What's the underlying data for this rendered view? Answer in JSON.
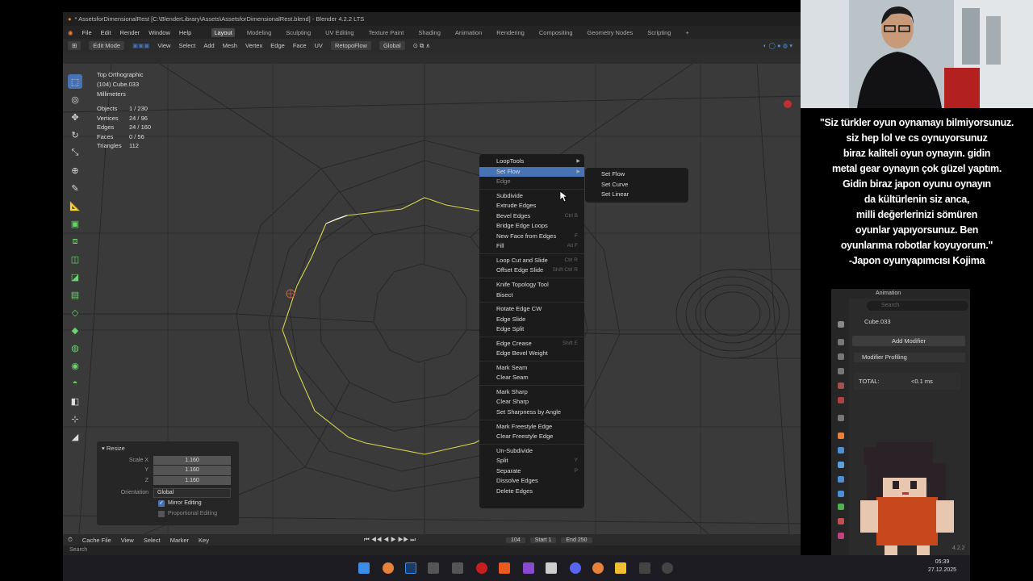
{
  "window_title": "* AssetsforDimensionalRest [C:\\BlenderLibrary\\Assets\\AssetsforDimensionalRest.blend] - Blender 4.2.2 LTS",
  "menu": [
    "File",
    "Edit",
    "Render",
    "Window",
    "Help"
  ],
  "workspaces": [
    "Layout",
    "Modeling",
    "Sculpting",
    "UV Editing",
    "Texture Paint",
    "Shading",
    "Animation",
    "Rendering",
    "Compositing",
    "Geometry Nodes",
    "Scripting"
  ],
  "header": {
    "mode": "Edit Mode",
    "items": [
      "View",
      "Select",
      "Add",
      "Mesh",
      "Vertex",
      "Edge",
      "Face",
      "UV"
    ],
    "retopo": "RetopoFlow",
    "orientation": "Global"
  },
  "viewport_info": {
    "view": "Top Orthographic",
    "object": "(104) Cube.033",
    "units": "Millimeters"
  },
  "stats": [
    {
      "k": "Objects",
      "v": "1 / 230"
    },
    {
      "k": "Vertices",
      "v": "24 / 96"
    },
    {
      "k": "Edges",
      "v": "24 / 160"
    },
    {
      "k": "Faces",
      "v": "0 / 56"
    },
    {
      "k": "Triangles",
      "v": "112"
    }
  ],
  "resize": {
    "title": "Resize",
    "scale_x_label": "Scale X",
    "y_label": "Y",
    "z_label": "Z",
    "sx": "1.160",
    "sy": "1.160",
    "sz": "1.160",
    "orientation_label": "Orientation",
    "orientation": "Global",
    "mirror": "Mirror Editing",
    "proportional": "Proportional Editing"
  },
  "context_menu": [
    {
      "label": "LoopTools",
      "arrow": true
    },
    {
      "label": "Set Flow",
      "arrow": true,
      "highlight": true
    },
    {
      "label": "Edge",
      "dim": true
    },
    {
      "sep": true
    },
    {
      "label": "Subdivide"
    },
    {
      "label": "Extrude Edges"
    },
    {
      "label": "Bevel Edges",
      "sc": "Ctrl B"
    },
    {
      "label": "Bridge Edge Loops"
    },
    {
      "label": "New Face from Edges",
      "sc": "F"
    },
    {
      "label": "Fill",
      "sc": "Alt F"
    },
    {
      "sep": true
    },
    {
      "label": "Loop Cut and Slide",
      "sc": "Ctrl R"
    },
    {
      "label": "Offset Edge Slide",
      "sc": "Shift Ctrl R"
    },
    {
      "sep": true
    },
    {
      "label": "Knife Topology Tool"
    },
    {
      "label": "Bisect"
    },
    {
      "sep": true
    },
    {
      "label": "Rotate Edge CW"
    },
    {
      "label": "Edge Slide"
    },
    {
      "label": "Edge Split"
    },
    {
      "sep": true
    },
    {
      "label": "Edge Crease",
      "sc": "Shift E"
    },
    {
      "label": "Edge Bevel Weight"
    },
    {
      "sep": true
    },
    {
      "label": "Mark Seam"
    },
    {
      "label": "Clear Seam"
    },
    {
      "sep": true
    },
    {
      "label": "Mark Sharp"
    },
    {
      "label": "Clear Sharp"
    },
    {
      "label": "Set Sharpness by Angle"
    },
    {
      "sep": true
    },
    {
      "label": "Mark Freestyle Edge"
    },
    {
      "label": "Clear Freestyle Edge"
    },
    {
      "sep": true
    },
    {
      "label": "Un-Subdivide"
    },
    {
      "label": "Split",
      "sc": "Y"
    },
    {
      "label": "Separate",
      "sc": "P"
    },
    {
      "label": "Dissolve Edges"
    },
    {
      "label": "Delete Edges"
    }
  ],
  "submenu": [
    "Set Flow",
    "Set Curve",
    "Set Linear"
  ],
  "timeline": {
    "items": [
      "Cache File",
      "View",
      "Select",
      "Marker",
      "Key"
    ],
    "frame": "104",
    "start_label": "Start",
    "start": "1",
    "end_label": "End",
    "end": "250"
  },
  "status": "Search",
  "quote": [
    "\"Siz türkler oyun oynamayı bilmiyorsunuz.",
    "siz hep lol ve cs oynuyorsunuz",
    "biraz kaliteli oyun oynayın. gidin",
    "metal gear oynayın çok güzel yaptım.",
    "Gidin biraz japon oyunu oynayın",
    "da kültürlenin siz anca,",
    "milli değerlerinizi sömüren",
    "oyunlar yapıyorsunuz. Ben",
    "oyunlarıma robotlar koyuyorum.\"",
    "-Japon oyunyapımcısı Kojima"
  ],
  "properties": {
    "header": "Animation",
    "search": "Search",
    "object": "Cube.033",
    "add_modifier": "Add Modifier",
    "profiling": "Modifier Profiling",
    "total_label": "TOTAL:",
    "total_value": "<0.1 ms",
    "version": "4.2.2"
  },
  "clock": {
    "time": "05:39",
    "date": "27.12.2025"
  },
  "colors": {
    "selected_edge": "#d6d650",
    "active_blue": "#4772b3",
    "blender_orange": "#e8823a"
  }
}
